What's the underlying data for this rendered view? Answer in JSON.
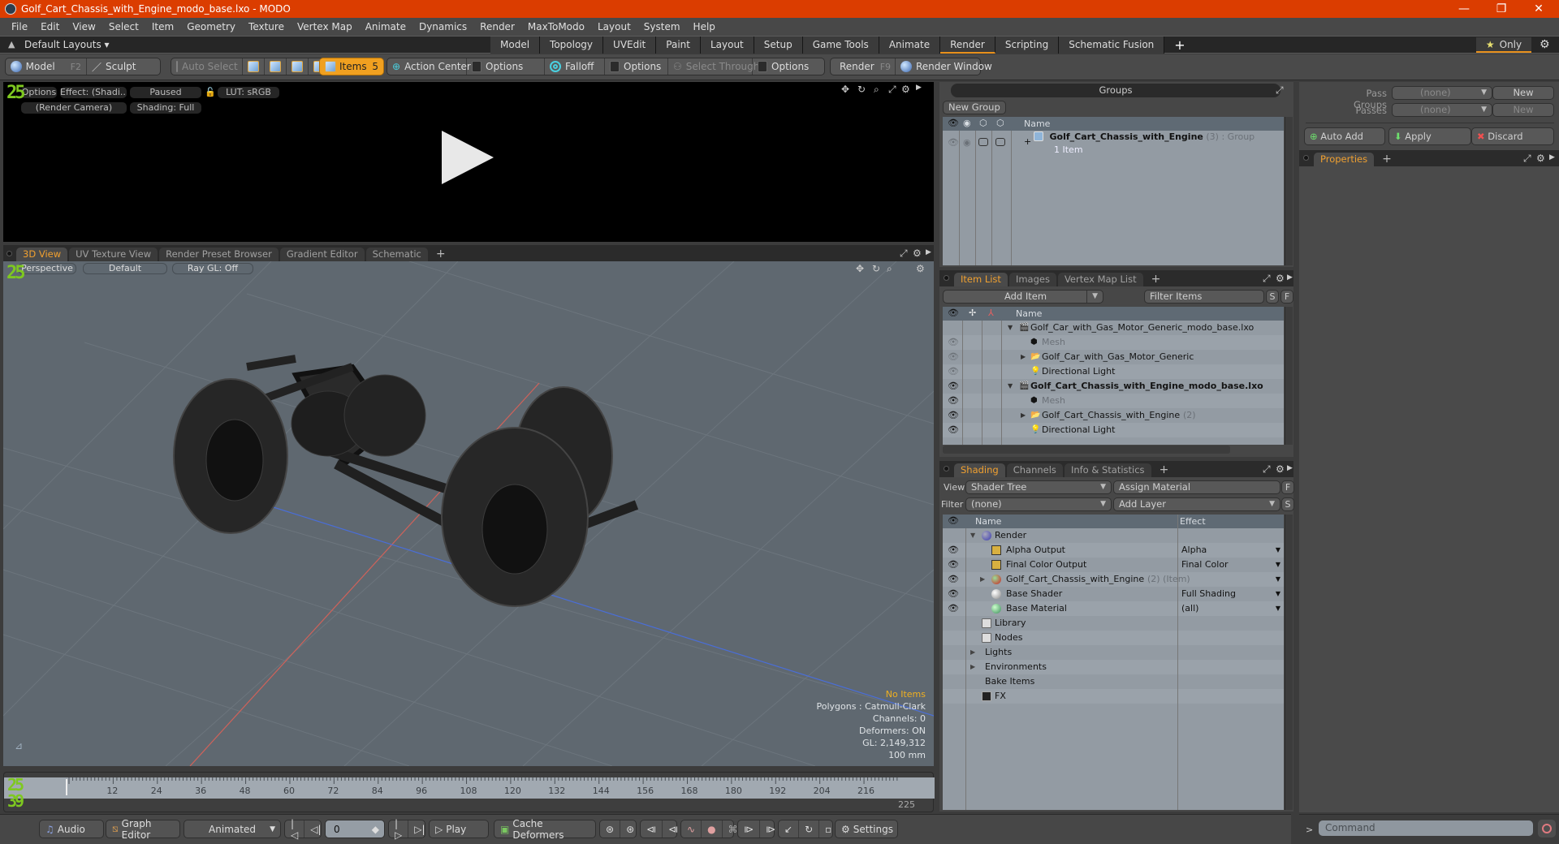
{
  "window": {
    "title": "Golf_Cart_Chassis_with_Engine_modo_base.lxo - MODO",
    "controls": [
      "minimize",
      "maximize",
      "close"
    ]
  },
  "menu": [
    "File",
    "Edit",
    "View",
    "Select",
    "Item",
    "Geometry",
    "Texture",
    "Vertex Map",
    "Animate",
    "Dynamics",
    "Render",
    "MaxToModo",
    "Layout",
    "System",
    "Help"
  ],
  "layoutbar": {
    "layout_label": "Default Layouts ▾",
    "tabs": [
      "Model",
      "Topology",
      "UVEdit",
      "Paint",
      "Layout",
      "Setup",
      "Game Tools",
      "Animate",
      "Render",
      "Scripting",
      "Schematic Fusion"
    ],
    "active_tab": "Render",
    "only_label": "Only"
  },
  "toolbar": {
    "model": "Model",
    "model_key": "F2",
    "sculpt": "Sculpt",
    "auto_select": "Auto Select",
    "items": "Items",
    "items_count": "5",
    "action_center": "Action Center",
    "options1": "Options",
    "falloff": "Falloff",
    "options2": "Options",
    "select_through": "Select Through",
    "options3": "Options",
    "render": "Render",
    "render_key": "F9",
    "render_window": "Render Window"
  },
  "render_preview": {
    "options": "Options",
    "effect": "Effect: (Shadi...",
    "status": "Paused",
    "lut": "LUT: sRGB",
    "camera": "(Render Camera)",
    "shading": "Shading: Full",
    "frame_badge": "25"
  },
  "view_tabs": {
    "tabs": [
      "3D View",
      "UV Texture View",
      "Render Preset Browser",
      "Gradient Editor",
      "Schematic"
    ],
    "active": "3D View"
  },
  "viewport": {
    "projection": "Perspective",
    "style": "Default",
    "raygl": "Ray GL: Off",
    "stats": {
      "selection": "No Items",
      "polygons": "Polygons : Catmull-Clark",
      "channels": "Channels: 0",
      "deformers": "Deformers: ON",
      "gl": "GL: 2,149,312",
      "scale": "100 mm"
    }
  },
  "timeline": {
    "ticks": [
      "12",
      "24",
      "36",
      "48",
      "60",
      "72",
      "84",
      "96",
      "108",
      "120",
      "132",
      "144",
      "156",
      "168",
      "180",
      "192",
      "204",
      "216"
    ],
    "end_frame": "225",
    "current_frame_marker": "0",
    "badge_top": "25",
    "badge_bottom": "39"
  },
  "bottombar": {
    "audio": "Audio",
    "graph_editor": "Graph Editor",
    "animated": "Animated",
    "frame_value": "0",
    "play": "Play",
    "cache_deformers": "Cache Deformers",
    "settings": "Settings"
  },
  "groups": {
    "title": "Groups",
    "new_group": "New Group",
    "column_name": "Name",
    "rows": [
      {
        "name": "Golf_Cart_Chassis_with_Engine",
        "count": "(3)",
        "type": ": Group",
        "sub": "1 Item"
      }
    ]
  },
  "passes": {
    "pass_groups_label": "Pass Groups",
    "pass_groups_value": "(none)",
    "passes_label": "Passes",
    "passes_value": "(none)",
    "new_label": "New",
    "auto_add": "Auto Add",
    "apply": "Apply",
    "discard": "Discard",
    "properties_tab": "Properties"
  },
  "item_list": {
    "tabs": [
      "Item List",
      "Images",
      "Vertex Map List"
    ],
    "active": "Item List",
    "add_item": "Add Item",
    "filter_placeholder": "Filter Items",
    "s_btn": "S",
    "f_btn": "F",
    "column_name": "Name",
    "rows": [
      {
        "name": "Golf_Car_with_Gas_Motor_Generic_modo_base.lxo",
        "level": 0,
        "icon": "scene-icon",
        "expand": "▼",
        "eye": "",
        "bold": false,
        "dim": false,
        "extra": ""
      },
      {
        "name": "Mesh",
        "level": 1,
        "icon": "mesh-icon",
        "expand": "",
        "eye": "dim",
        "bold": false,
        "dim": true,
        "extra": ""
      },
      {
        "name": "Golf_Car_with_Gas_Motor_Generic",
        "level": 1,
        "icon": "folder-icon",
        "expand": "▶",
        "eye": "dim",
        "bold": false,
        "dim": false,
        "extra": ""
      },
      {
        "name": "Directional Light",
        "level": 1,
        "icon": "light-icon",
        "expand": "",
        "eye": "dim",
        "bold": false,
        "dim": false,
        "extra": ""
      },
      {
        "name": "Golf_Cart_Chassis_with_Engine_modo_base.lxo",
        "level": 0,
        "icon": "scene-icon",
        "expand": "▼",
        "eye": "on",
        "bold": true,
        "dim": false,
        "extra": ""
      },
      {
        "name": "Mesh",
        "level": 1,
        "icon": "mesh-icon",
        "expand": "",
        "eye": "on",
        "bold": false,
        "dim": true,
        "extra": ""
      },
      {
        "name": "Golf_Cart_Chassis_with_Engine",
        "level": 1,
        "icon": "folder-icon",
        "expand": "▶",
        "eye": "on",
        "bold": false,
        "dim": false,
        "extra": "(2)"
      },
      {
        "name": "Directional Light",
        "level": 1,
        "icon": "light-icon",
        "expand": "",
        "eye": "on",
        "bold": false,
        "dim": false,
        "extra": ""
      }
    ]
  },
  "shading": {
    "tabs": [
      "Shading",
      "Channels",
      "Info & Statistics"
    ],
    "active": "Shading",
    "view_label": "View",
    "view_value": "Shader Tree",
    "assign_material": "Assign Material",
    "filter_label": "Filter",
    "filter_value": "(none)",
    "add_layer": "Add Layer",
    "f_btn": "F",
    "s_btn": "S",
    "col_name": "Name",
    "col_effect": "Effect",
    "rows": [
      {
        "name": "Render",
        "level": 0,
        "icon": "render-sphere-icon",
        "expand": "▼",
        "eye": false,
        "effect": "",
        "extra": "",
        "dropdown": false
      },
      {
        "name": "Alpha Output",
        "level": 1,
        "icon": "output-icon",
        "expand": "",
        "eye": true,
        "effect": "Alpha",
        "extra": "",
        "dropdown": true
      },
      {
        "name": "Final Color Output",
        "level": 1,
        "icon": "output-icon",
        "expand": "",
        "eye": true,
        "effect": "Final Color",
        "extra": "",
        "dropdown": true
      },
      {
        "name": "Golf_Cart_Chassis_with_Engine",
        "level": 1,
        "icon": "material-group-icon",
        "expand": "▶",
        "eye": true,
        "effect": "",
        "extra": "(2) (Item)",
        "dropdown": true
      },
      {
        "name": "Base Shader",
        "level": 1,
        "icon": "shader-icon",
        "expand": "",
        "eye": true,
        "effect": "Full Shading",
        "extra": "",
        "dropdown": true
      },
      {
        "name": "Base Material",
        "level": 1,
        "icon": "material-icon",
        "expand": "",
        "eye": true,
        "effect": "(all)",
        "extra": "",
        "dropdown": true
      },
      {
        "name": "Library",
        "level": 0,
        "icon": "folder-icon",
        "expand": "",
        "eye": false,
        "effect": "",
        "extra": "",
        "dropdown": false
      },
      {
        "name": "Nodes",
        "level": 0,
        "icon": "folder-icon",
        "expand": "",
        "eye": false,
        "effect": "",
        "extra": "",
        "dropdown": false
      },
      {
        "name": "Lights",
        "level": 0,
        "icon": "",
        "expand": "▶",
        "eye": false,
        "effect": "",
        "extra": "",
        "dropdown": false
      },
      {
        "name": "Environments",
        "level": 0,
        "icon": "",
        "expand": "▶",
        "eye": false,
        "effect": "",
        "extra": "",
        "dropdown": false
      },
      {
        "name": "Bake Items",
        "level": 0,
        "icon": "",
        "expand": "",
        "eye": false,
        "effect": "",
        "extra": "",
        "dropdown": false
      },
      {
        "name": "FX",
        "level": 0,
        "icon": "scene-icon",
        "expand": "",
        "eye": false,
        "effect": "",
        "extra": "",
        "dropdown": false
      }
    ]
  },
  "command": {
    "placeholder": "Command",
    "prompt": ">"
  }
}
